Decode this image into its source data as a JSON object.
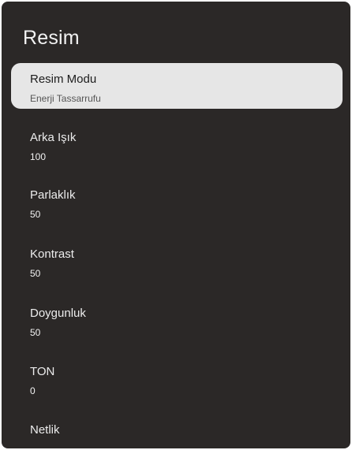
{
  "page": {
    "title": "Resim"
  },
  "items": [
    {
      "label": "Resim Modu",
      "value": "Enerji Tassarrufu"
    },
    {
      "label": "Arka Işık",
      "value": "100"
    },
    {
      "label": "Parlaklık",
      "value": "50"
    },
    {
      "label": "Kontrast",
      "value": "50"
    },
    {
      "label": "Doygunluk",
      "value": "50"
    },
    {
      "label": "TON",
      "value": "0"
    },
    {
      "label": "Netlik",
      "value": ""
    }
  ],
  "colors": {
    "panel_bg": "#2b2827",
    "selected_bg": "#e6e6e6",
    "text": "#ececec",
    "selected_text": "#1c1c1c"
  }
}
